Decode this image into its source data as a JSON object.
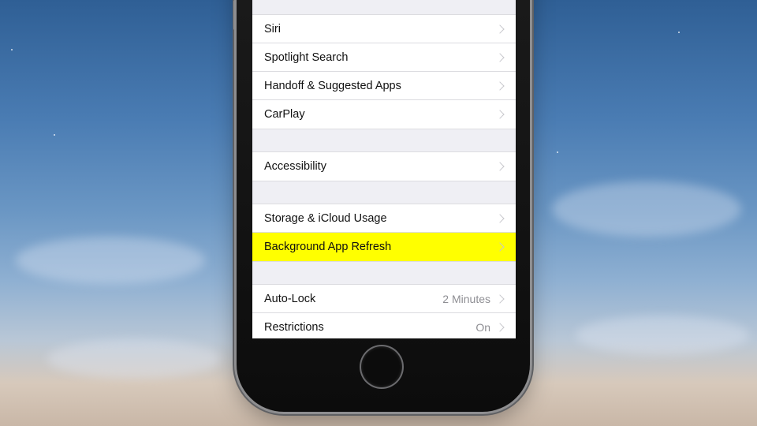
{
  "settings": {
    "items": [
      {
        "label": "Siri",
        "value": ""
      },
      {
        "label": "Spotlight Search",
        "value": ""
      },
      {
        "label": "Handoff & Suggested Apps",
        "value": ""
      },
      {
        "label": "CarPlay",
        "value": ""
      },
      {
        "label": "Accessibility",
        "value": ""
      },
      {
        "label": "Storage & iCloud Usage",
        "value": ""
      },
      {
        "label": "Background App Refresh",
        "value": "",
        "highlighted": true
      },
      {
        "label": "Auto-Lock",
        "value": "2 Minutes"
      },
      {
        "label": "Restrictions",
        "value": "On"
      }
    ]
  },
  "colors": {
    "highlight": "#ffff00",
    "chevron": "#c7c7cc",
    "value_text": "#8e8e93",
    "grouped_background": "#efeff4"
  },
  "icons": {
    "row_disclosure": "chevron-right-icon",
    "home": "home-button"
  }
}
